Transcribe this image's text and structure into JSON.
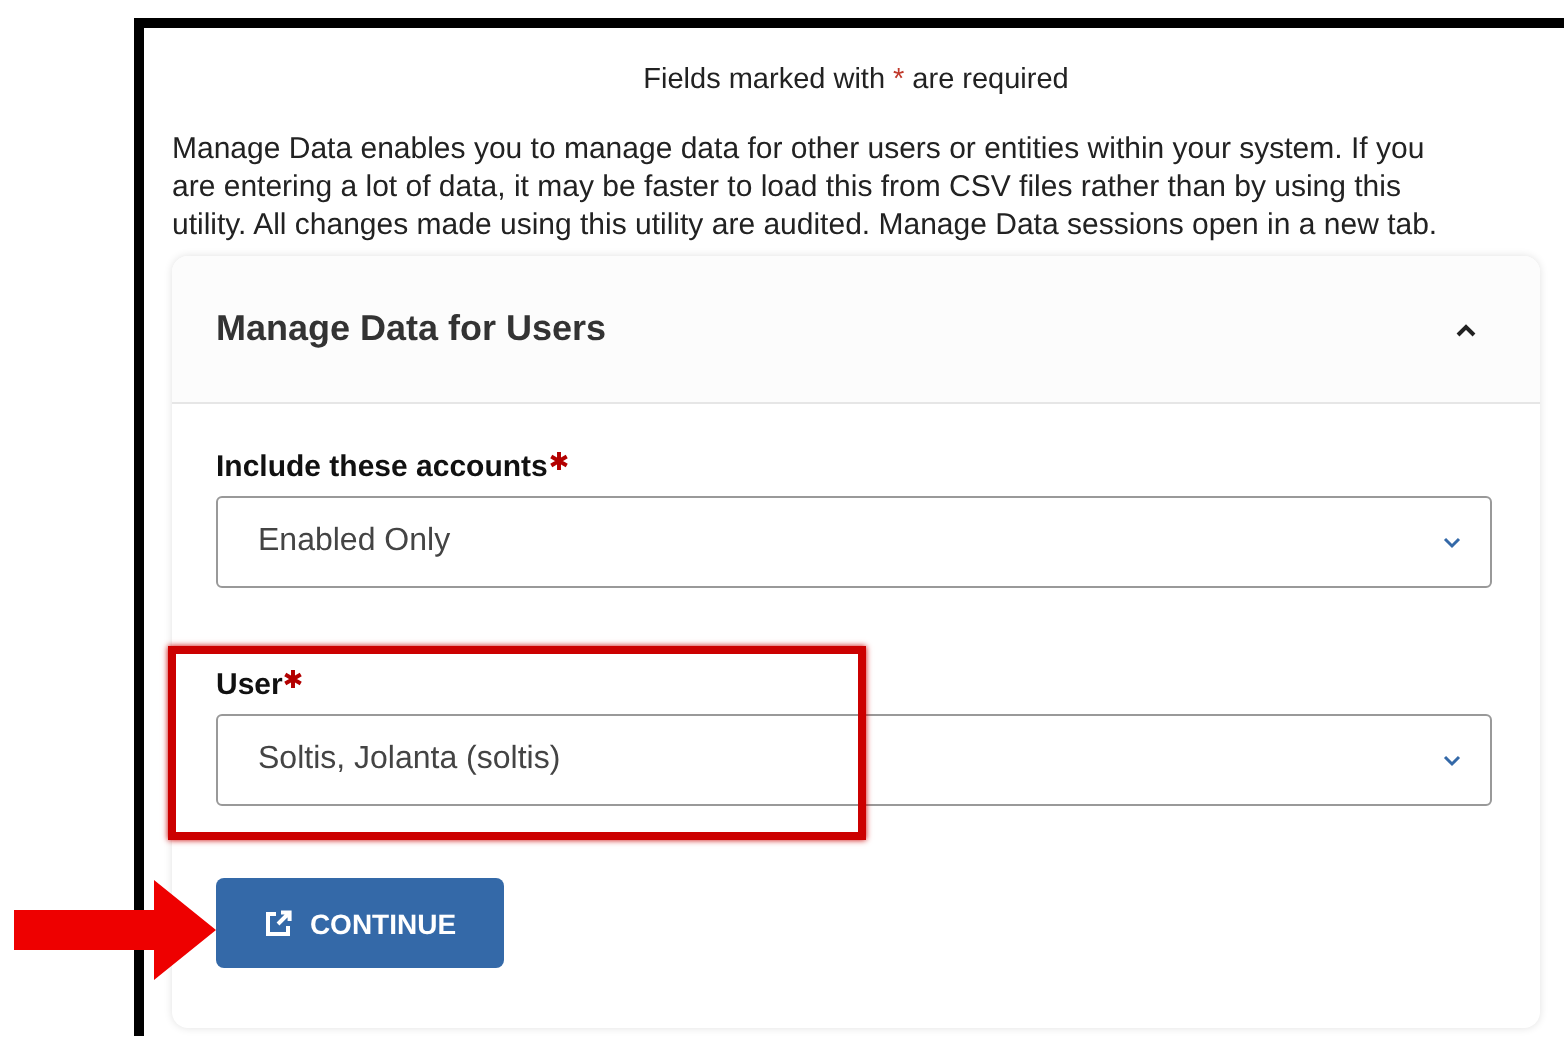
{
  "required_note": {
    "before": "Fields marked with",
    "mark": "*",
    "after": "are required"
  },
  "intro": "Manage Data enables you to manage data for other users or entities within your system. If you are entering a lot of data, it may be faster to load this from CSV files rather than by using this utility. All changes made using this utility are audited. Manage Data sessions open in a new tab.",
  "panel": {
    "title": "Manage Data for Users",
    "expanded": true,
    "fields": [
      {
        "label": "Include these accounts",
        "required": true,
        "value": "Enabled Only"
      },
      {
        "label": "User",
        "required": true,
        "value": "Soltis, Jolanta (soltis)"
      }
    ],
    "button": {
      "label": "CONTINUE"
    }
  },
  "annotations": {
    "highlight_frame": true,
    "pointer_arrow": true
  }
}
